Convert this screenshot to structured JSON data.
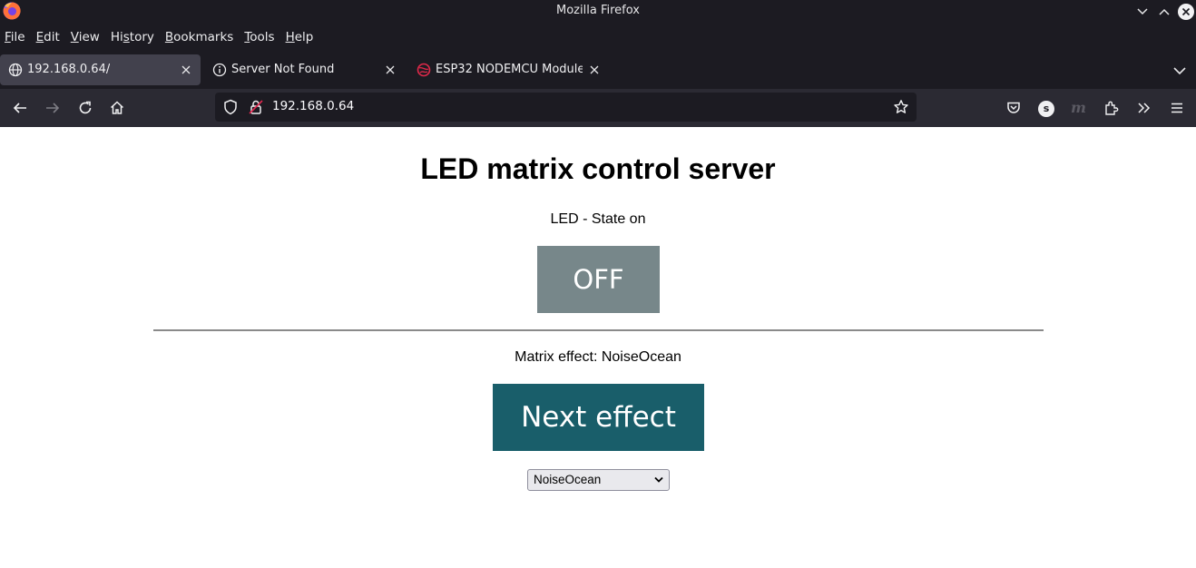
{
  "window": {
    "title": "Mozilla Firefox"
  },
  "menu": [
    {
      "pre": "",
      "u": "F",
      "post": "ile"
    },
    {
      "pre": "",
      "u": "E",
      "post": "dit"
    },
    {
      "pre": "",
      "u": "V",
      "post": "iew"
    },
    {
      "pre": "Hi",
      "u": "s",
      "post": "tory"
    },
    {
      "pre": "",
      "u": "B",
      "post": "ookmarks"
    },
    {
      "pre": "",
      "u": "T",
      "post": "ools"
    },
    {
      "pre": "",
      "u": "H",
      "post": "elp"
    }
  ],
  "tabs": [
    {
      "label": "192.168.0.64/",
      "icon": "globe-icon",
      "active": true
    },
    {
      "label": "Server Not Found",
      "icon": "info-icon",
      "active": false
    },
    {
      "label": "ESP32 NODEMCU Module",
      "icon": "site-favicon-icon",
      "active": false
    }
  ],
  "urlbar": {
    "url": "192.168.0.64"
  },
  "toolbar": {
    "account_initial": "s",
    "extension_letter": "m"
  },
  "page": {
    "title": "LED matrix control server",
    "state_text": "LED - State on",
    "toggle_label": "OFF",
    "effect_text": "Matrix effect: NoiseOcean",
    "next_label": "Next effect",
    "selected_effect": "NoiseOcean"
  },
  "colors": {
    "chrome_dark": "#1c1b22",
    "toolbar": "#2b2a33",
    "active_tab": "#42414d",
    "off_button": "#77878a",
    "next_button": "#195e6a"
  }
}
